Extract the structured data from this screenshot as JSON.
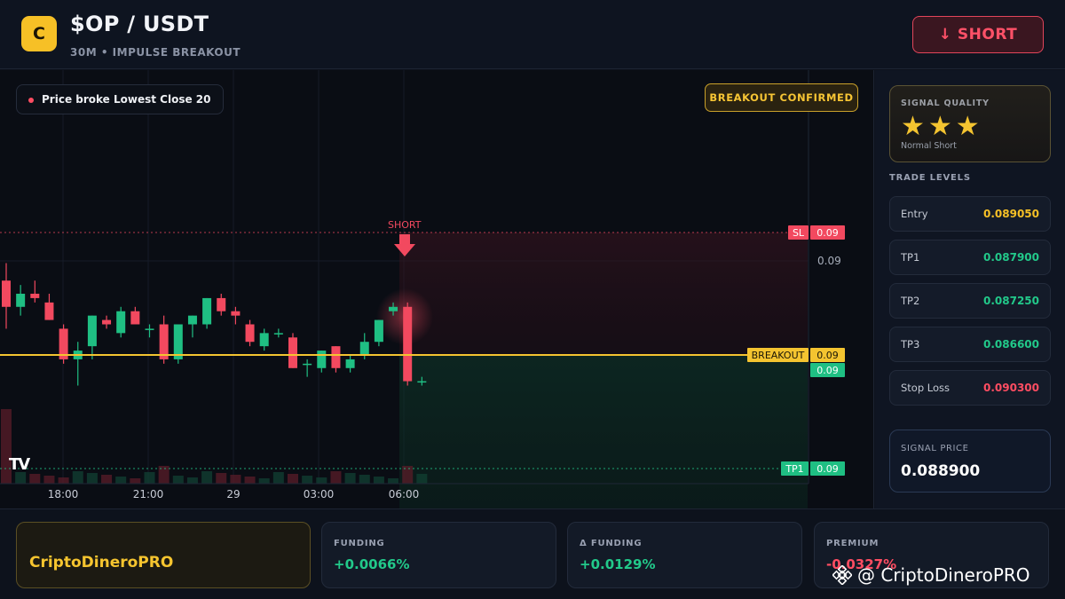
{
  "header": {
    "logo_letter": "C",
    "pair": "$OP / USDT",
    "subtitle": "30M • IMPULSE BREAKOUT",
    "direction_button": "↓ SHORT"
  },
  "chart": {
    "pill_text": "Price broke Lowest Close 20",
    "confirmed_badge": "BREAKOUT CONFIRMED",
    "tv_logo": "TV",
    "signal_marker": "SHORT",
    "axis_price": "0.09",
    "levels": {
      "sl": {
        "label": "SL",
        "value": "0.09"
      },
      "breakout": {
        "label": "BREAKOUT",
        "value": "0.09"
      },
      "current": {
        "value": "0.09"
      },
      "tp1": {
        "label": "TP1",
        "value": "0.09"
      }
    },
    "x_labels": [
      "18:00",
      "21:00",
      "29",
      "03:00",
      "06:00"
    ]
  },
  "chart_data": {
    "type": "candlestick",
    "title": "$OP / USDT",
    "interval": "30M",
    "x_tick_labels": [
      "18:00",
      "21:00",
      "29",
      "03:00",
      "06:00"
    ],
    "price_unit": "USDT",
    "price_range": [
      0.0866,
      0.0904
    ],
    "candles": [
      {
        "o": 0.08975,
        "h": 0.08995,
        "l": 0.0892,
        "c": 0.08945,
        "dir": "down"
      },
      {
        "o": 0.08945,
        "h": 0.0897,
        "l": 0.08935,
        "c": 0.0896,
        "dir": "up"
      },
      {
        "o": 0.0896,
        "h": 0.08975,
        "l": 0.0895,
        "c": 0.08955,
        "dir": "down"
      },
      {
        "o": 0.0895,
        "h": 0.0896,
        "l": 0.0893,
        "c": 0.0893,
        "dir": "down"
      },
      {
        "o": 0.0892,
        "h": 0.08925,
        "l": 0.0888,
        "c": 0.08885,
        "dir": "down"
      },
      {
        "o": 0.08885,
        "h": 0.08905,
        "l": 0.08855,
        "c": 0.08895,
        "dir": "up"
      },
      {
        "o": 0.089,
        "h": 0.08935,
        "l": 0.08885,
        "c": 0.08935,
        "dir": "up"
      },
      {
        "o": 0.0893,
        "h": 0.08935,
        "l": 0.0892,
        "c": 0.08925,
        "dir": "down"
      },
      {
        "o": 0.08915,
        "h": 0.08945,
        "l": 0.0891,
        "c": 0.0894,
        "dir": "up"
      },
      {
        "o": 0.0894,
        "h": 0.08945,
        "l": 0.08925,
        "c": 0.08925,
        "dir": "down"
      },
      {
        "o": 0.0892,
        "h": 0.08925,
        "l": 0.0891,
        "c": 0.0892,
        "dir": "flat"
      },
      {
        "o": 0.08925,
        "h": 0.08935,
        "l": 0.0888,
        "c": 0.08885,
        "dir": "down"
      },
      {
        "o": 0.08885,
        "h": 0.08925,
        "l": 0.0888,
        "c": 0.08925,
        "dir": "up"
      },
      {
        "o": 0.08925,
        "h": 0.08935,
        "l": 0.0891,
        "c": 0.08935,
        "dir": "up"
      },
      {
        "o": 0.08925,
        "h": 0.08955,
        "l": 0.0892,
        "c": 0.08955,
        "dir": "up"
      },
      {
        "o": 0.08955,
        "h": 0.0896,
        "l": 0.08935,
        "c": 0.0894,
        "dir": "down"
      },
      {
        "o": 0.0894,
        "h": 0.08945,
        "l": 0.08925,
        "c": 0.08935,
        "dir": "down"
      },
      {
        "o": 0.08925,
        "h": 0.0893,
        "l": 0.089,
        "c": 0.08905,
        "dir": "down"
      },
      {
        "o": 0.089,
        "h": 0.0892,
        "l": 0.08895,
        "c": 0.08915,
        "dir": "up"
      },
      {
        "o": 0.08915,
        "h": 0.0892,
        "l": 0.0891,
        "c": 0.08915,
        "dir": "flat"
      },
      {
        "o": 0.0891,
        "h": 0.08915,
        "l": 0.08875,
        "c": 0.08875,
        "dir": "down"
      },
      {
        "o": 0.0888,
        "h": 0.08885,
        "l": 0.08865,
        "c": 0.0888,
        "dir": "flat"
      },
      {
        "o": 0.08875,
        "h": 0.08895,
        "l": 0.0887,
        "c": 0.08895,
        "dir": "up"
      },
      {
        "o": 0.089,
        "h": 0.089,
        "l": 0.0887,
        "c": 0.08875,
        "dir": "down"
      },
      {
        "o": 0.08875,
        "h": 0.0889,
        "l": 0.0887,
        "c": 0.08885,
        "dir": "up"
      },
      {
        "o": 0.0889,
        "h": 0.08915,
        "l": 0.08885,
        "c": 0.08905,
        "dir": "up"
      },
      {
        "o": 0.08905,
        "h": 0.0893,
        "l": 0.089,
        "c": 0.0893,
        "dir": "up"
      },
      {
        "o": 0.0894,
        "h": 0.0895,
        "l": 0.08935,
        "c": 0.08945,
        "dir": "up"
      },
      {
        "o": 0.08945,
        "h": 0.0895,
        "l": 0.08855,
        "c": 0.0886,
        "dir": "down"
      },
      {
        "o": 0.0886,
        "h": 0.08865,
        "l": 0.08855,
        "c": 0.0886,
        "dir": "flat"
      }
    ],
    "levels": {
      "stop_loss": 0.0903,
      "breakout": 0.0889,
      "tp1": 0.0879
    },
    "signal_candle_index": 28,
    "signal": "SHORT"
  },
  "colors": {
    "up": "#1fbf83",
    "down": "#f2495f",
    "accent": "#f6c026",
    "short": "#ff4d62"
  },
  "side": {
    "quality_title": "SIGNAL QUALITY",
    "stars": "★★★",
    "quality_note": "Normal Short",
    "levels_title": "TRADE LEVELS",
    "levels": [
      {
        "label": "Entry",
        "value": "0.089050",
        "color": "#f6c026"
      },
      {
        "label": "TP1",
        "value": "0.087900",
        "color": "#22c98a"
      },
      {
        "label": "TP2",
        "value": "0.087250",
        "color": "#22c98a"
      },
      {
        "label": "TP3",
        "value": "0.086600",
        "color": "#22c98a"
      },
      {
        "label": "Stop Loss",
        "value": "0.090300",
        "color": "#ff4d62"
      }
    ],
    "signal_price_label": "SIGNAL PRICE",
    "signal_price": "0.088900"
  },
  "footer": {
    "brand": "CriptoDineroPRO",
    "stats": [
      {
        "label": "FUNDING",
        "value": "+0.0066%",
        "color": "#22c98a"
      },
      {
        "label": "Δ FUNDING",
        "value": "+0.0129%",
        "color": "#22c98a"
      },
      {
        "label": "PREMIUM",
        "value": "-0.0327%",
        "color": "#ff4d62"
      }
    ],
    "watermark": "@ CriptoDineroPRO"
  }
}
